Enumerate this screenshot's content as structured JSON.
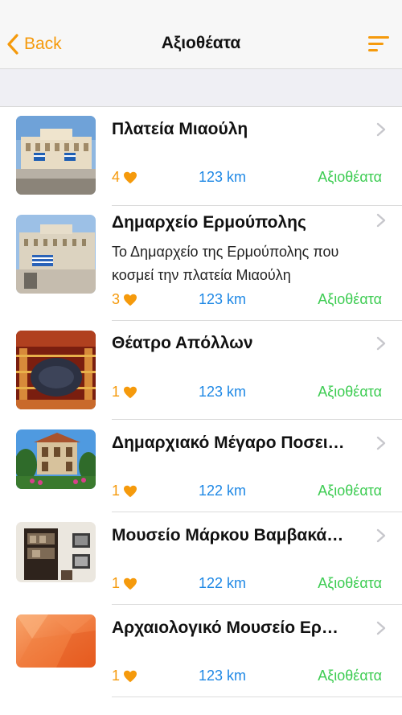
{
  "nav": {
    "back_label": "Back",
    "title": "Αξιοθέατα",
    "accent_color": "#f59a0c"
  },
  "colors": {
    "likes": "#f59a0c",
    "distance": "#1e88e5",
    "category": "#3dcc52"
  },
  "items": [
    {
      "title": "Πλατεία Μιαούλη",
      "description": "",
      "likes": "4",
      "distance": "123 km",
      "category": "Αξιοθέατα",
      "thumb": "square-photo"
    },
    {
      "title": "Δημαρχείο Ερμούπολης",
      "description": "Το Δημαρχείο της Ερμούπολης που κοσμεί την πλατεία Μιαούλη",
      "likes": "3",
      "distance": "123 km",
      "category": "Αξιοθέατα",
      "thumb": "town-hall-photo"
    },
    {
      "title": "Θέατρο Απόλλων",
      "description": "",
      "likes": "1",
      "distance": "123 km",
      "category": "Αξιοθέατα",
      "thumb": "theater-photo"
    },
    {
      "title": "Δημαρχιακό Μέγαρο Ποσει…",
      "description": "",
      "likes": "1",
      "distance": "122 km",
      "category": "Αξιοθέατα",
      "thumb": "mansion-photo"
    },
    {
      "title": "Μουσείο Μάρκου Βαμβακά…",
      "description": "",
      "likes": "1",
      "distance": "122 km",
      "category": "Αξιοθέατα",
      "thumb": "museum-photo"
    },
    {
      "title": "Αρχαιολογικό Μουσείο Ερ…",
      "description": "",
      "likes": "1",
      "distance": "123 km",
      "category": "Αξιοθέατα",
      "thumb": "placeholder-orange"
    }
  ]
}
